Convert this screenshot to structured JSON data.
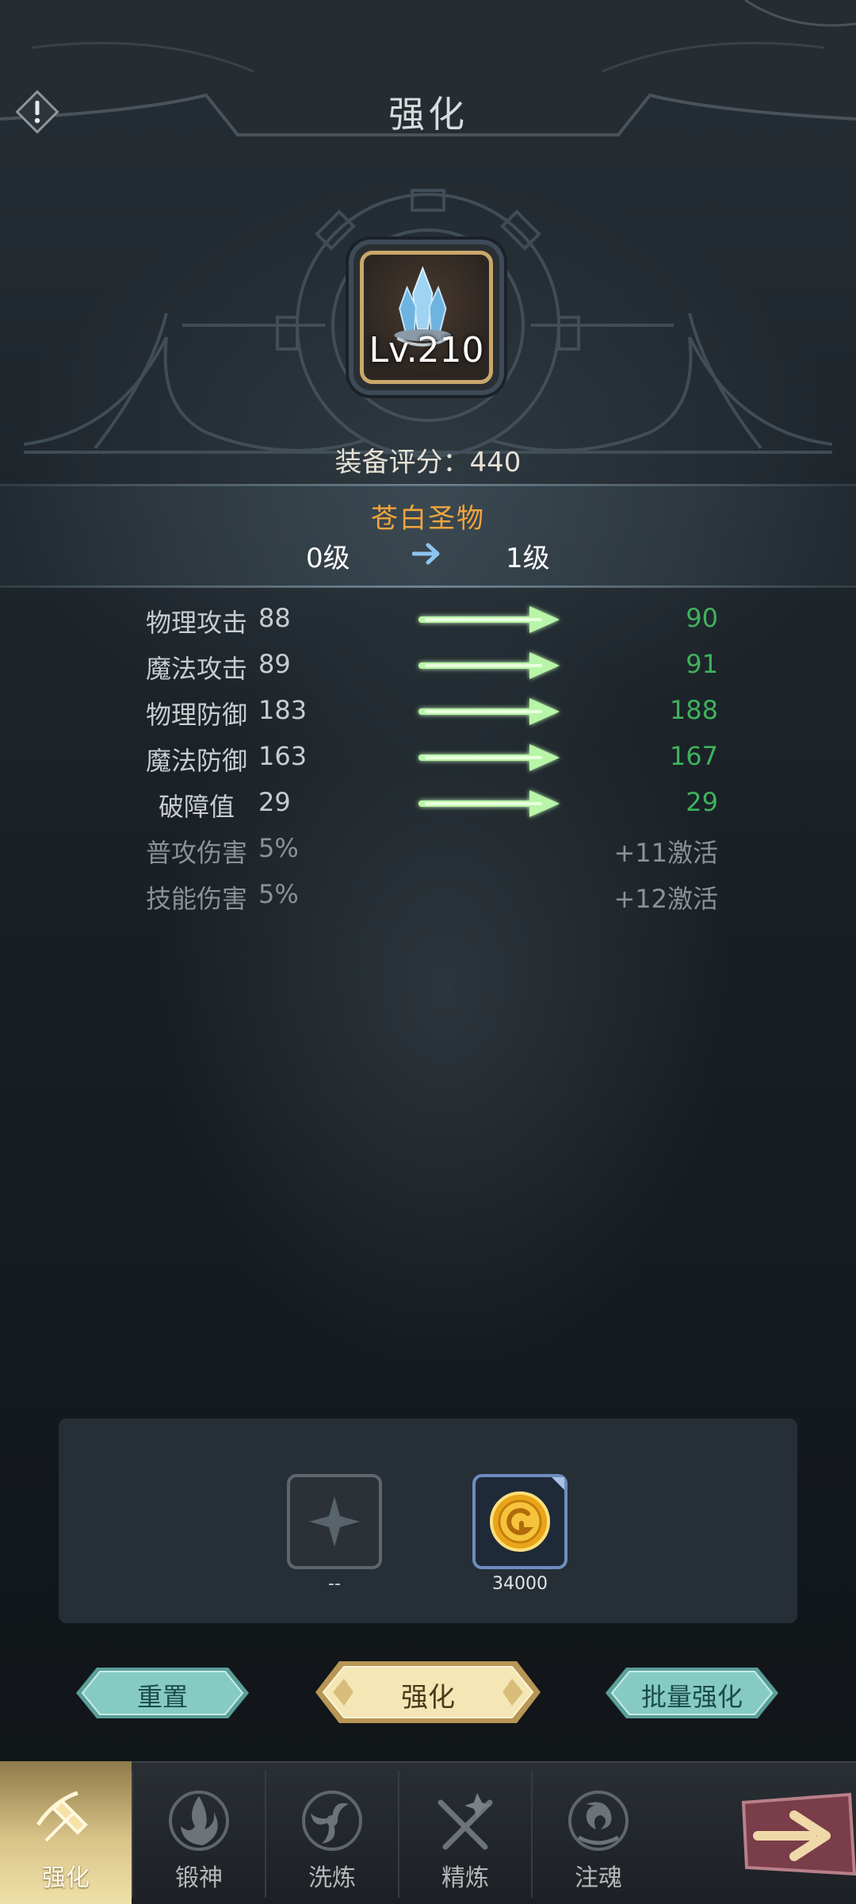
{
  "header": {
    "title": "强化",
    "info_icon": "exclamation-icon"
  },
  "equipment": {
    "icon": "crystal-icon",
    "level": "Lv.210",
    "score_text": "装备评分：440",
    "name": "苍白圣物",
    "level_from": "0级",
    "level_to": "1级"
  },
  "stats": [
    {
      "label": "物理攻击",
      "value": "88",
      "new": "90"
    },
    {
      "label": "魔法攻击",
      "value": "89",
      "new": "91"
    },
    {
      "label": "物理防御",
      "value": "183",
      "new": "188"
    },
    {
      "label": "魔法防御",
      "value": "163",
      "new": "167"
    },
    {
      "label": "破障值",
      "value": "29",
      "new": "29"
    },
    {
      "label": "普攻伤害",
      "value": "5%",
      "new": "+11激活"
    },
    {
      "label": "技能伤害",
      "value": "5%",
      "new": "+12激活"
    }
  ],
  "materials": {
    "empty_slot_icon": "plus-icon",
    "empty_slot_label": "--",
    "coin_icon": "gold-coin-icon",
    "coin_amount": "34000"
  },
  "buttons": {
    "reset": "重置",
    "enhance": "强化",
    "batch": "批量强化"
  },
  "tabs": [
    {
      "label": "强化",
      "icon": "enhance-hammer-icon",
      "active": true
    },
    {
      "label": "锻神",
      "icon": "forge-flame-icon",
      "active": false
    },
    {
      "label": "洗炼",
      "icon": "refine-swirl-icon",
      "active": false
    },
    {
      "label": "精炼",
      "icon": "crossed-swords-icon",
      "active": false
    },
    {
      "label": "注魂",
      "icon": "soul-flame-icon",
      "active": false
    }
  ],
  "next_icon": "next-arrow-icon",
  "colors": {
    "accent_gold": "#f0a53c",
    "stat_up_green": "#3fb25c",
    "button_teal": "#7fc5bd",
    "button_gold": "#f3e4b0"
  }
}
